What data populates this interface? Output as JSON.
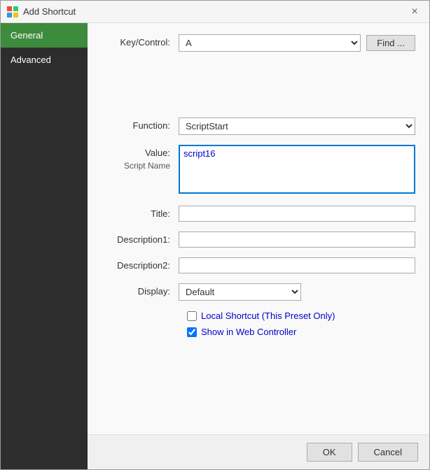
{
  "window": {
    "title": "Add Shortcut",
    "close_label": "×"
  },
  "sidebar": {
    "items": [
      {
        "id": "general",
        "label": "General",
        "active": true
      },
      {
        "id": "advanced",
        "label": "Advanced",
        "active": false
      }
    ]
  },
  "form": {
    "key_control_label": "Key/Control:",
    "key_value": "A",
    "find_button_label": "Find ...",
    "function_label": "Function:",
    "function_value": "ScriptStart",
    "function_options": [
      "ScriptStart"
    ],
    "value_label": "Value:",
    "script_name_label": "Script Name",
    "value_text": "script16",
    "title_label": "Title:",
    "title_value": "",
    "desc1_label": "Description1:",
    "desc1_value": "",
    "desc2_label": "Description2:",
    "desc2_value": "",
    "display_label": "Display:",
    "display_value": "Default",
    "display_options": [
      "Default"
    ],
    "checkbox_local": {
      "label": "Local Shortcut (This Preset Only)",
      "checked": false
    },
    "checkbox_web": {
      "label": "Show in Web Controller",
      "checked": true
    }
  },
  "footer": {
    "ok_label": "OK",
    "cancel_label": "Cancel"
  }
}
